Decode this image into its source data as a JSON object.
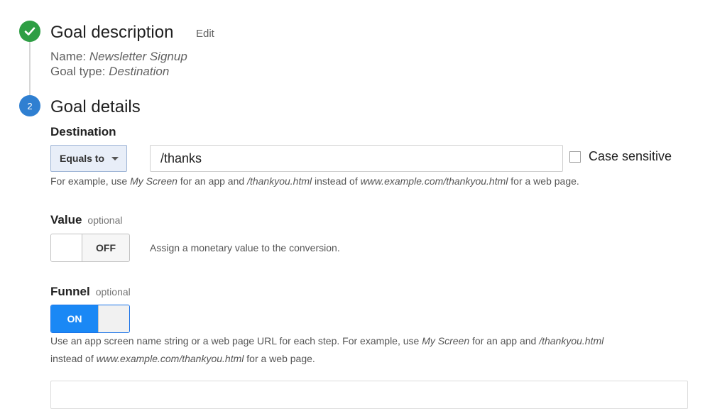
{
  "goal_description": {
    "title": "Goal description",
    "edit_label": "Edit",
    "name_label": "Name:",
    "name_value": "Newsletter Signup",
    "type_label": "Goal type:",
    "type_value": "Destination",
    "icon": "check-icon"
  },
  "goal_details": {
    "step_number": "2",
    "title": "Goal details",
    "destination": {
      "label": "Destination",
      "match_type": "Equals to",
      "value": "/thanks",
      "case_sensitive_label": "Case sensitive",
      "case_sensitive_checked": false,
      "help": {
        "p1": "For example, use ",
        "e1": "My Screen",
        "p2": " for an app and ",
        "e2": "/thankyou.html",
        "p3": " instead of ",
        "e3": "www.example.com/thankyou.html",
        "p4": " for a web page."
      }
    },
    "value": {
      "label": "Value",
      "optional": "optional",
      "toggle_state": "OFF",
      "help": "Assign a monetary value to the conversion."
    },
    "funnel": {
      "label": "Funnel",
      "optional": "optional",
      "toggle_state": "ON",
      "help": {
        "p1": "Use an app screen name string or a web page URL for each step. For example, use ",
        "e1": "My Screen",
        "p2": " for an app and ",
        "e2": "/thankyou.html",
        "p3": "instead of ",
        "e3": "www.example.com/thankyou.html",
        "p4": " for a web page."
      }
    }
  },
  "colors": {
    "step_done": "#2e9e44",
    "step_current": "#2f7fd1",
    "toggle_on": "#1a88f5"
  }
}
